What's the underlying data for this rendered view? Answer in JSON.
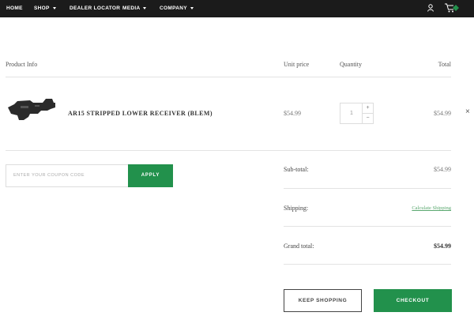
{
  "nav": {
    "home": "HOME",
    "shop": "SHOP",
    "dealer_locator": "DEALER LOCATOR",
    "media": "MEDIA",
    "company": "COMPANY"
  },
  "headers": {
    "product_info": "Product Info",
    "unit_price": "Unit price",
    "quantity": "Quantity",
    "total": "Total"
  },
  "item": {
    "name": "AR15 STRIPPED LOWER RECEIVER (BLEM)",
    "unit_price": "$54.99",
    "quantity": "1",
    "total": "$54.99",
    "qty_up": "+",
    "qty_down": "−",
    "remove": "×"
  },
  "coupon": {
    "placeholder": "ENTER YOUR COUPON CODE",
    "apply_label": "APPLY"
  },
  "summary": {
    "subtotal_label": "Sub-total:",
    "subtotal_value": "$54.99",
    "shipping_label": "Shipping:",
    "shipping_link": "Calculate Shipping",
    "grand_label": "Grand total:",
    "grand_value": "$54.99"
  },
  "actions": {
    "keep_shopping": "KEEP SHOPPING",
    "checkout": "CHECKOUT"
  },
  "colors": {
    "accent": "#22914c",
    "nav_bg": "#1b1b1b"
  },
  "icons": [
    "user-icon",
    "cart-icon",
    "close-icon",
    "chevron-down-icon"
  ]
}
